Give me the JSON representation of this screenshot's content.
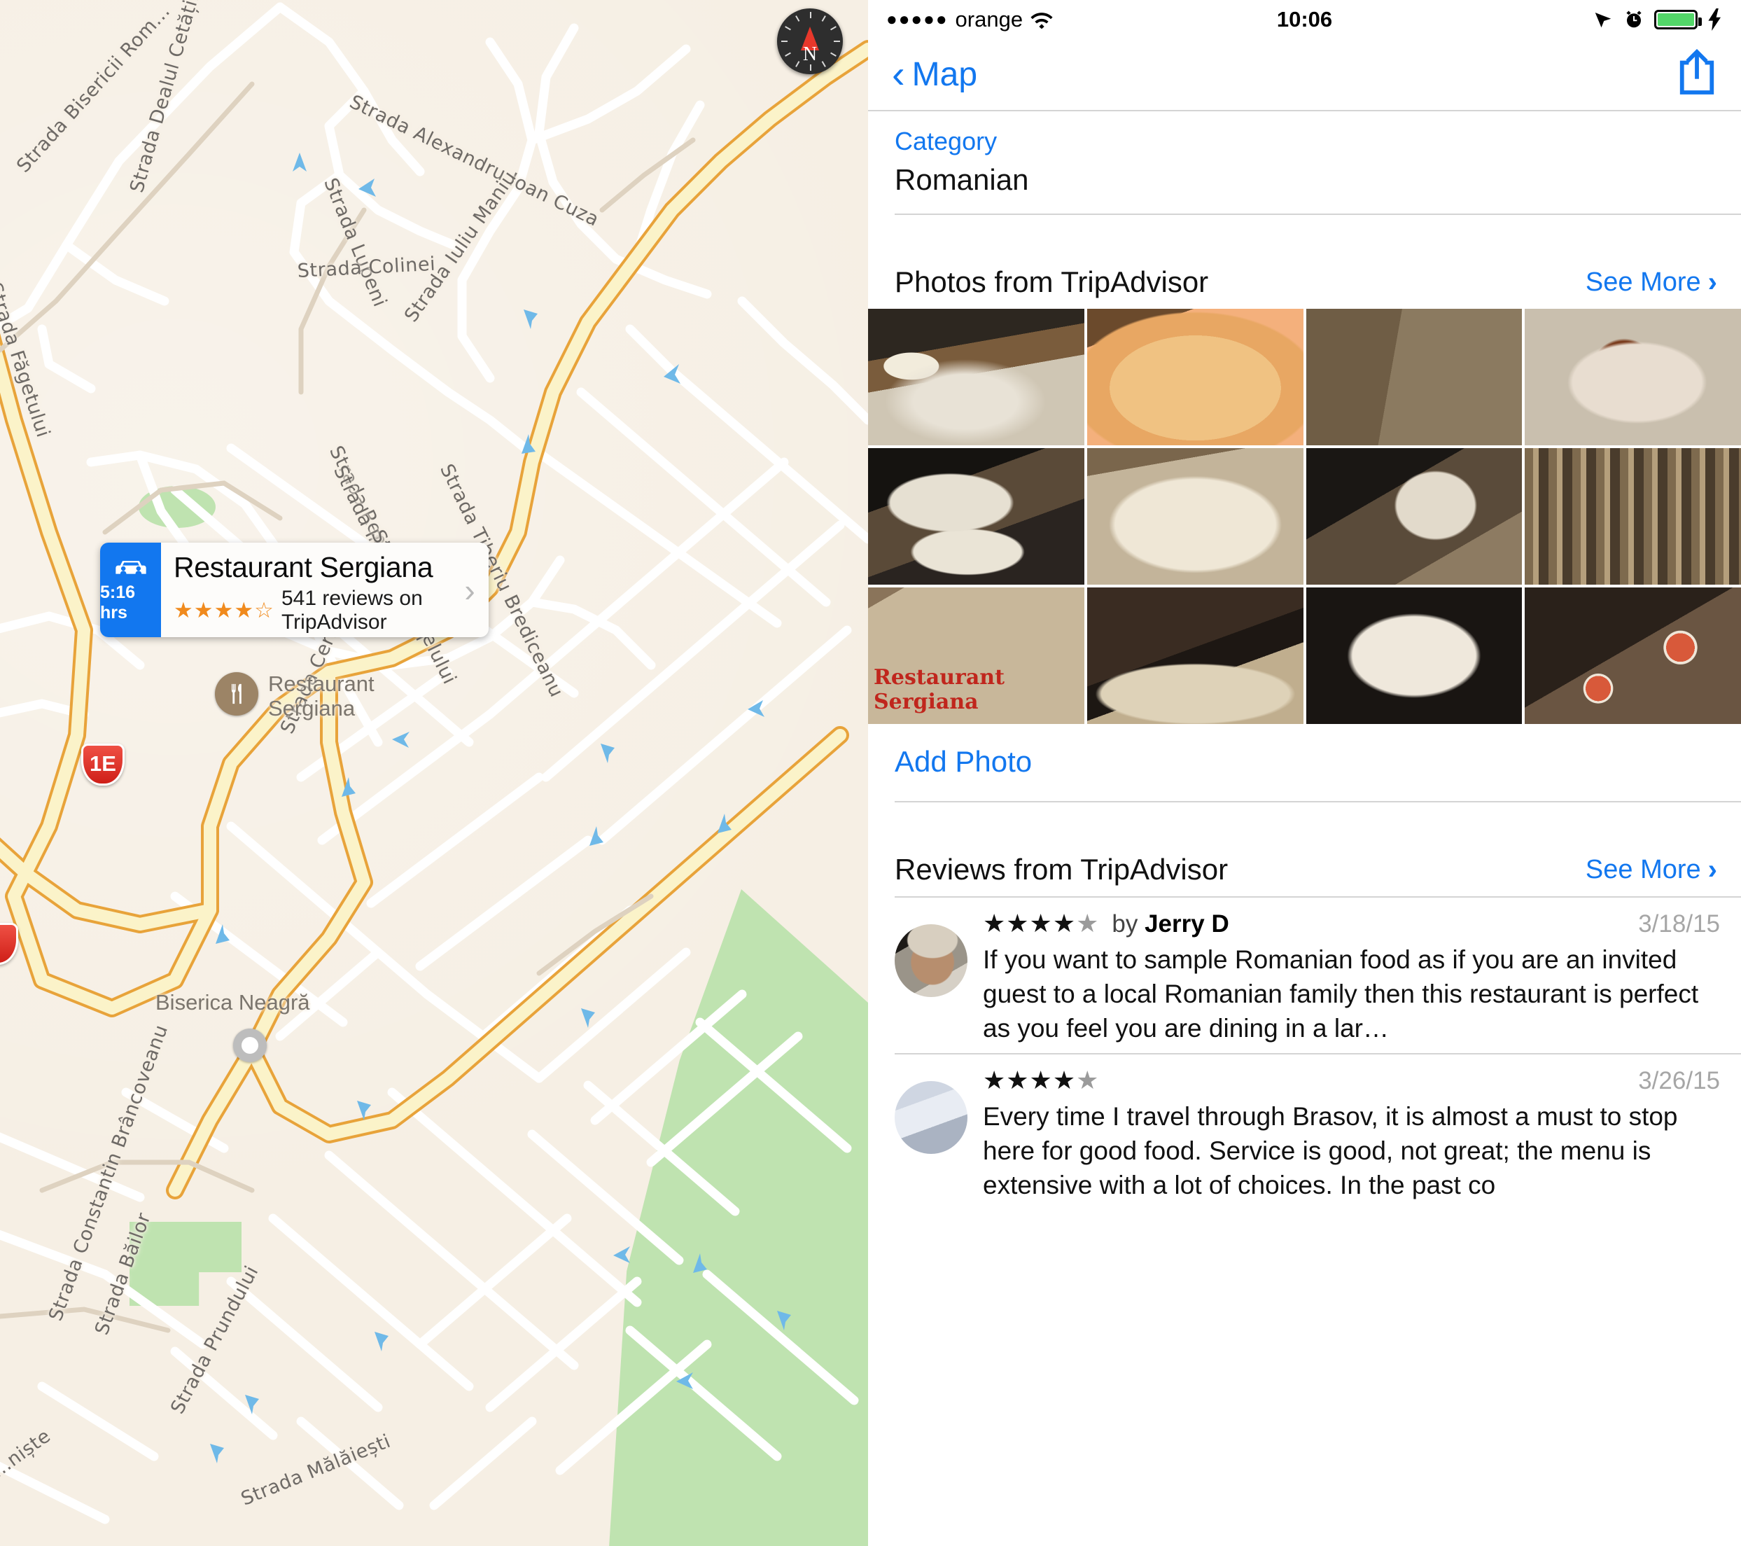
{
  "status_bar": {
    "signal_dots": "●●●●●",
    "carrier": "orange",
    "wifi_icon": "wifi-icon",
    "time": "10:06",
    "location_icon": "location-arrow-icon",
    "alarm_icon": "alarm-clock-icon",
    "battery_icon": "battery-icon",
    "battery_level": "100",
    "charging_icon": "lightning-bolt-icon"
  },
  "nav_bar": {
    "back_label": "Map",
    "back_icon": "chevron-left-icon",
    "share_icon": "share-icon"
  },
  "category": {
    "label": "Category",
    "value": "Romanian"
  },
  "photos_section": {
    "title": "Photos from TripAdvisor",
    "see_more": "See More",
    "see_more_icon": "chevron-right-icon",
    "add_photo": "Add Photo",
    "photos": [
      {
        "name": "grilled-meat-rolls-plate",
        "caption": ""
      },
      {
        "name": "cabbage-rolls-with-polenta",
        "caption": ""
      },
      {
        "name": "two-carafes-of-wine",
        "caption": ""
      },
      {
        "name": "beef-stew-with-tomatoes",
        "caption": ""
      },
      {
        "name": "dessert-with-cherry-sauce",
        "caption": ""
      },
      {
        "name": "chicken-in-cream-sauce-with-polenta",
        "caption": ""
      },
      {
        "name": "table-setting-with-wine-glass",
        "caption": ""
      },
      {
        "name": "wine-cellar-shelf",
        "caption": ""
      },
      {
        "name": "restaurant-sergiana-burlap-sign",
        "caption": "Restaurant\nSergiana"
      },
      {
        "name": "open-menu-book-on-table",
        "caption": ""
      },
      {
        "name": "grilled-vegetable-platter",
        "caption": ""
      },
      {
        "name": "tomato-soup-bowls-on-table",
        "caption": ""
      }
    ]
  },
  "reviews_section": {
    "title": "Reviews from TripAdvisor",
    "see_more": "See More",
    "see_more_icon": "chevron-right-icon",
    "reviews": [
      {
        "stars_filled": 4,
        "stars_total": 5,
        "by_prefix": "by",
        "author": "Jerry D",
        "date": "3/18/15",
        "avatar": "reviewer-avatar-jerry-d",
        "text": "If you want to sample Romanian food as if you are an invited guest to a local Romanian family then this restaurant is perfect as you feel you are dining in a lar…"
      },
      {
        "stars_filled": 4,
        "stars_total": 5,
        "by_prefix": "",
        "author": "",
        "date": "3/26/15",
        "avatar": "reviewer-avatar-second",
        "text": "Every time I travel through Brasov, it is almost a must to stop here for good food.  Service is good, not great; the menu is extensive with a lot of choices.  In the past co"
      }
    ]
  },
  "map": {
    "callout": {
      "eta": "5:16 hrs",
      "drive_icon": "car-icon",
      "title": "Restaurant Sergiana",
      "stars": "★★★★☆",
      "reviews_text": "541 reviews on TripAdvisor",
      "chevron_icon": "chevron-right-icon"
    },
    "compass": {
      "icon": "compass-icon",
      "north_letter": "N"
    },
    "route_shield": "1E",
    "pois": [
      {
        "name": "restaurant-sergiana-pin",
        "label": "Restaurant\nSergiana",
        "icon": "restaurant-fork-knife-icon"
      },
      {
        "name": "biserica-neagra-pin",
        "label": "Biserica Neagră",
        "icon": "place-dot-icon"
      }
    ],
    "streets": [
      "Strada Bisericii Rom...",
      "Strada Dealul Cetății",
      "Strada Alexandru Ioan Cuza",
      "Strada Lupeni",
      "Strada Colinei",
      "Strada Iuliu Maniu",
      "Strada Făgetului",
      "Strada Republicii",
      "Strada Postăvarului",
      "Strada Castelului",
      "Strada Tiberiu Brediceanu",
      "Strada Cerbului",
      "Strada Constantin Brâncoveanu",
      "Strada Băilor",
      "Strada Prundului",
      "Strada Mălăiești",
      "...niște"
    ]
  },
  "colors": {
    "accent_blue": "#1277ef",
    "star_orange": "#f08a1d",
    "map_bg": "#f6efe4",
    "park_green": "#bfe3b0",
    "battery_green": "#53d769",
    "shield_red": "#cf1f18"
  }
}
